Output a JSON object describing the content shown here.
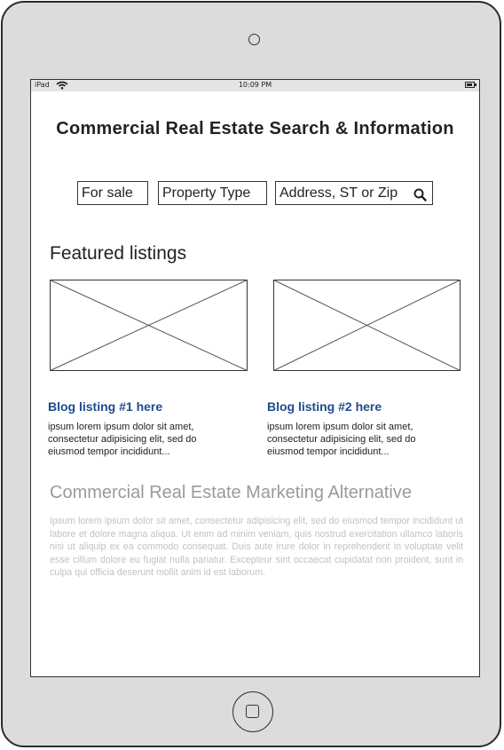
{
  "status_bar": {
    "carrier": "iPad",
    "time": "10:09 PM"
  },
  "header": {
    "title": "Commercial Real Estate Search & Information"
  },
  "search": {
    "listing_filter": "For sale",
    "property_type": "Property Type",
    "address_placeholder": "Address, ST or Zip"
  },
  "featured": {
    "heading": "Featured listings"
  },
  "blog_listings": [
    {
      "title": "Blog listing #1 here",
      "excerpt": "ipsum lorem ipsum dolor sit amet, consectetur adipisicing elit, sed do eiusmod tempor incididunt..."
    },
    {
      "title": "Blog listing #2 here",
      "excerpt": "ipsum lorem ipsum dolor sit amet, consectetur adipisicing elit, sed do eiusmod tempor incididunt..."
    }
  ],
  "marketing": {
    "heading": "Commercial Real Estate Marketing Alternative",
    "body": "Ipsum lorem ipsum dolor sit amet, consectetur adipisicing elit, sed do eiusmod tempor incididunt ut labore et dolore magna aliqua. Ut enim ad minim veniam, quis nostrud exercitation ullamco laboris nisi ut aliquip ex ea commodo consequat. Duis aute irure dolor in reprehenderit in voluptate velit esse cillum dolore eu fugiat nulla pariatur. Excepteur sint occaecat cupidatat non proident, sunt in culpa qui officia deserunt mollit anim id est laborum."
  },
  "colors": {
    "device_body": "#dcdcdc",
    "blog_title": "#1f4b8e",
    "muted_heading": "#9a9a9a",
    "muted_text": "#c2c2c2"
  },
  "icons": [
    "wifi-icon",
    "battery-icon",
    "search-icon",
    "image-placeholder-icon",
    "camera-icon",
    "home-button-icon"
  ]
}
